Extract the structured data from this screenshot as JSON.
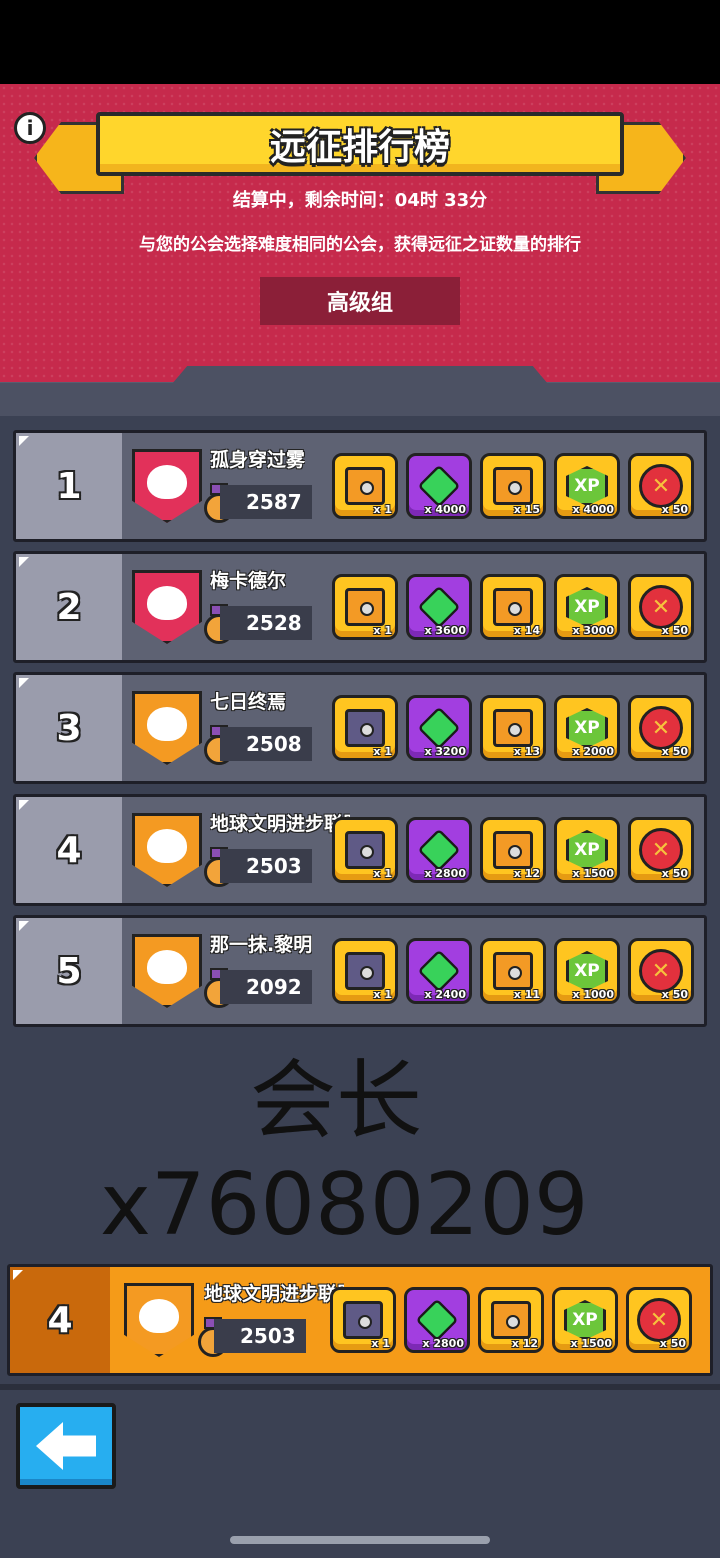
{
  "header": {
    "title": "远征排行榜",
    "timer": "结算中，剩余时间：04时 33分",
    "description": "与您的公会选择难度相同的公会，获得远征之证数量的排行",
    "group": "高级组",
    "info_icon": "i"
  },
  "rows": [
    {
      "rank": "1",
      "name": "孤身穿过雾",
      "score": "2587",
      "badge": "red-cat",
      "rewards": [
        {
          "icon": "gold-chest",
          "qty": "x 1"
        },
        {
          "icon": "gem",
          "qty": "x 4000"
        },
        {
          "icon": "orange-chest",
          "qty": "x 15"
        },
        {
          "icon": "xp",
          "qty": "x 4000"
        },
        {
          "icon": "token",
          "qty": "x 50"
        }
      ]
    },
    {
      "rank": "2",
      "name": "梅卡德尔",
      "score": "2528",
      "badge": "red-bear",
      "rewards": [
        {
          "icon": "gold-chest",
          "qty": "x 1"
        },
        {
          "icon": "gem",
          "qty": "x 3600"
        },
        {
          "icon": "orange-chest",
          "qty": "x 14"
        },
        {
          "icon": "xp",
          "qty": "x 3000"
        },
        {
          "icon": "token",
          "qty": "x 50"
        }
      ]
    },
    {
      "rank": "3",
      "name": "七日终焉",
      "score": "2508",
      "badge": "orange-bunny",
      "rewards": [
        {
          "icon": "dark-chest",
          "qty": "x 1"
        },
        {
          "icon": "gem",
          "qty": "x 3200"
        },
        {
          "icon": "orange-chest",
          "qty": "x 13"
        },
        {
          "icon": "xp",
          "qty": "x 2000"
        },
        {
          "icon": "token",
          "qty": "x 50"
        }
      ]
    },
    {
      "rank": "4",
      "name": "地球文明进步联盟",
      "score": "2503",
      "badge": "orange-bunny",
      "rewards": [
        {
          "icon": "dark-chest",
          "qty": "x 1"
        },
        {
          "icon": "gem",
          "qty": "x 2800"
        },
        {
          "icon": "orange-chest",
          "qty": "x 12"
        },
        {
          "icon": "xp",
          "qty": "x 1500"
        },
        {
          "icon": "token",
          "qty": "x 50"
        }
      ]
    },
    {
      "rank": "5",
      "name": "那一抹.黎明",
      "score": "2092",
      "badge": "orange-cat",
      "rewards": [
        {
          "icon": "dark-chest",
          "qty": "x 1"
        },
        {
          "icon": "gem",
          "qty": "x 2400"
        },
        {
          "icon": "orange-chest",
          "qty": "x 11"
        },
        {
          "icon": "xp",
          "qty": "x 1000"
        },
        {
          "icon": "token",
          "qty": "x 50"
        }
      ]
    }
  ],
  "watermark": {
    "line1": "会长",
    "line2": "x76080209"
  },
  "my_row": {
    "rank": "4",
    "name": "地球文明进步联盟",
    "score": "2503",
    "rewards": [
      {
        "qty": "x 1"
      },
      {
        "qty": "x 2800"
      },
      {
        "qty": "x 12"
      },
      {
        "qty": "x 1500"
      },
      {
        "qty": "x 50"
      }
    ]
  },
  "xp_label": "XP",
  "colors": {
    "header": "#c62a4c",
    "banner": "#ffd62c",
    "my_row": "#f59b18",
    "back_button": "#27aef0"
  }
}
